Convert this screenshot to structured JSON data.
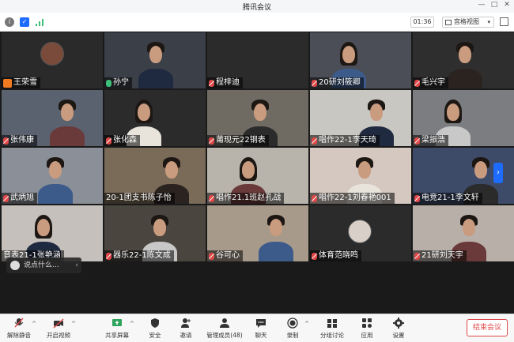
{
  "window": {
    "title": "腾讯会议"
  },
  "toolbar": {
    "timer": "01:36",
    "view_label": "宫格视图"
  },
  "participants": [
    {
      "name": "王荣雪",
      "mic": "host"
    },
    {
      "name": "孙宁",
      "mic": "on"
    },
    {
      "name": "程梓迪",
      "mic": "off"
    },
    {
      "name": "20研刘筱卿",
      "mic": "off"
    },
    {
      "name": "毛兴宇",
      "mic": "off"
    },
    {
      "name": "张伟康",
      "mic": "off"
    },
    {
      "name": "张化森",
      "mic": "off"
    },
    {
      "name": "莆现元22钢表",
      "mic": "off"
    },
    {
      "name": "唱作22-1李天琦",
      "mic": "off"
    },
    {
      "name": "梁振浩",
      "mic": "off"
    },
    {
      "name": "武炳旭",
      "mic": "off"
    },
    {
      "name": "20-1团支书陈子怡",
      "mic": "none"
    },
    {
      "name": "唱作21.1班赵孔战",
      "mic": "off"
    },
    {
      "name": "唱作22-1刘春艳001",
      "mic": "off"
    },
    {
      "name": "电竞21-1李文轩",
      "mic": "off"
    },
    {
      "name": "音表21-1张艳涵",
      "mic": "none"
    },
    {
      "name": "器乐22-1陈文成",
      "mic": "off"
    },
    {
      "name": "谷可心",
      "mic": "off"
    },
    {
      "name": "体育范晓鸣",
      "mic": "off"
    },
    {
      "name": "21研刘天宇",
      "mic": "off"
    }
  ],
  "chat": {
    "placeholder": "说点什么..."
  },
  "bottombar": {
    "unmute": "解除静音",
    "video": "开启视频",
    "share": "共享屏幕",
    "security": "安全",
    "invite": "邀请",
    "members": "管理成员(48)",
    "chat": "聊天",
    "record": "录制",
    "breakout": "分组讨论",
    "apps": "应用",
    "settings": "设置",
    "end": "结束会议"
  },
  "colors": {
    "accent": "#1e6bff",
    "danger": "#e04848",
    "active_speaker": "#3bb36b"
  }
}
